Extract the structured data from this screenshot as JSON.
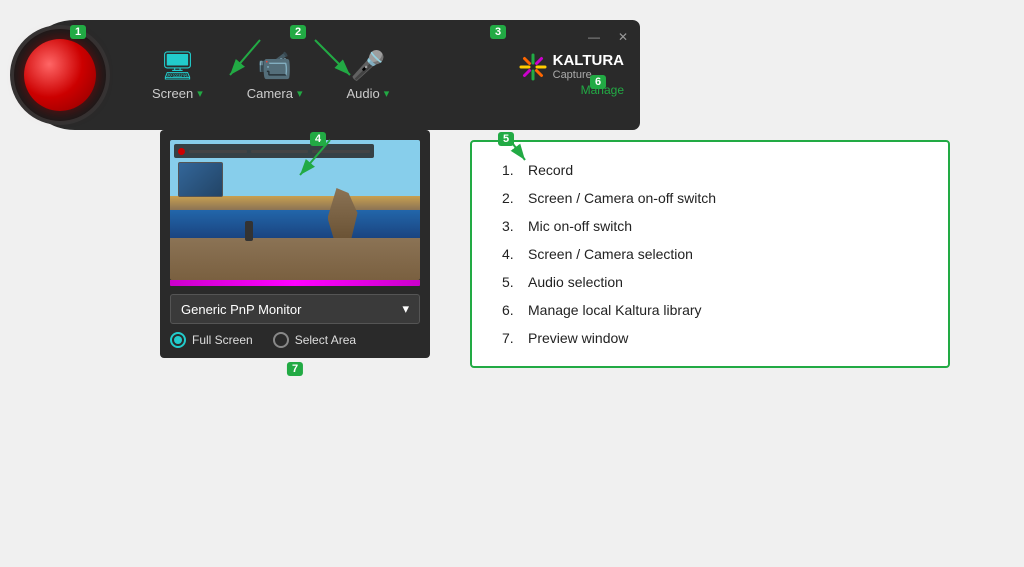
{
  "toolbar": {
    "record_badge": "1",
    "screen_camera_badge": "2",
    "mic_badge": "3",
    "screen_camera_sel_badge": "4",
    "audio_sel_badge": "5",
    "manage_badge": "6",
    "preview_badge": "7",
    "screen_label": "Screen",
    "camera_label": "Camera",
    "audio_label": "Audio",
    "brand_kaltura": "KALTURA",
    "brand_capture": "Capture",
    "manage_label": "Manage",
    "minimize": "—",
    "close": "✕"
  },
  "preview": {
    "monitor_label": "Generic PnP Monitor",
    "full_screen_label": "Full Screen",
    "select_area_label": "Select Area"
  },
  "info": {
    "items": [
      {
        "num": "1.",
        "text": "Record"
      },
      {
        "num": "2.",
        "text": "Screen / Camera on-off switch"
      },
      {
        "num": "3.",
        "text": "Mic on-off switch"
      },
      {
        "num": "4.",
        "text": "Screen / Camera selection"
      },
      {
        "num": "5.",
        "text": "Audio selection"
      },
      {
        "num": "6.",
        "text": "Manage local Kaltura library"
      },
      {
        "num": "7.",
        "text": "Preview window"
      }
    ]
  }
}
